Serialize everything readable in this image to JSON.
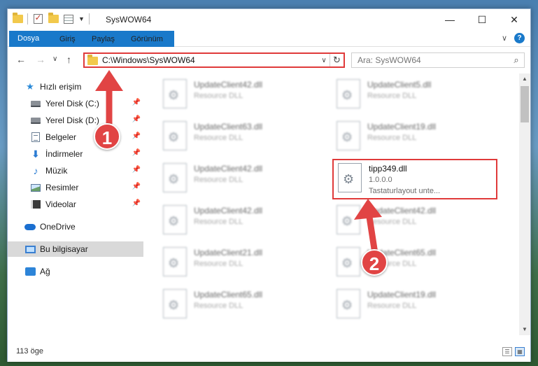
{
  "window": {
    "title": "SysWOW64",
    "controls": {
      "minimize": "—",
      "maximize": "☐",
      "close": "✕"
    }
  },
  "ribbon": {
    "tabs": [
      "Dosya",
      "Giriş",
      "Paylaş",
      "Görünüm"
    ],
    "expand": "∨",
    "help": "?"
  },
  "nav": {
    "back": "←",
    "forward": "→",
    "recent": "∨",
    "up": "↑",
    "address": "C:\\Windows\\SysWOW64",
    "address_dropdown": "∨",
    "refresh": "↻",
    "search_placeholder": "Ara: SysWOW64",
    "search_icon": "⌕"
  },
  "sidebar": {
    "items": [
      {
        "label": "Hızlı erişim",
        "icon": "star-icon",
        "pinned": false
      },
      {
        "label": "Yerel Disk (C:)",
        "icon": "drive-icon",
        "pinned": true
      },
      {
        "label": "Yerel Disk (D:)",
        "icon": "drive-icon",
        "pinned": true
      },
      {
        "label": "Belgeler",
        "icon": "documents-icon",
        "pinned": true
      },
      {
        "label": "İndirmeler",
        "icon": "download-icon",
        "pinned": true
      },
      {
        "label": "Müzik",
        "icon": "music-icon",
        "pinned": true
      },
      {
        "label": "Resimler",
        "icon": "pictures-icon",
        "pinned": true
      },
      {
        "label": "Videolar",
        "icon": "videos-icon",
        "pinned": true
      },
      {
        "label": "OneDrive",
        "icon": "onedrive-icon",
        "pinned": false
      },
      {
        "label": "Bu bilgisayar",
        "icon": "computer-icon",
        "pinned": false,
        "selected": true
      },
      {
        "label": "Ağ",
        "icon": "network-icon",
        "pinned": false
      }
    ],
    "pin_glyph": "📌"
  },
  "files": {
    "left": [
      {
        "name": "UpdateClient42.dll",
        "desc": "Resource DLL"
      },
      {
        "name": "UpdateClient63.dll",
        "desc": "Resource DLL"
      },
      {
        "name": "UpdateClient42.dll",
        "desc": "Resource DLL"
      },
      {
        "name": "UpdateClient42.dll",
        "desc": "Resource DLL"
      },
      {
        "name": "UpdateClient21.dll",
        "desc": "Resource DLL"
      },
      {
        "name": "UpdateClient65.dll",
        "desc": "Resource DLL"
      }
    ],
    "right": [
      {
        "name": "UpdateClient5.dll",
        "desc": "Resource DLL"
      },
      {
        "name": "UpdateClient19.dll",
        "desc": "Resource DLL"
      },
      {
        "name": "tipp349.dll",
        "desc": "1.0.0.0",
        "desc2": "Tastaturlayout unte...",
        "highlight": true
      },
      {
        "name": "UpdateClient42.dll",
        "desc": "Resource DLL"
      },
      {
        "name": "UpdateClient65.dll",
        "desc": "Resource DLL"
      },
      {
        "name": "UpdateClient19.dll",
        "desc": "Resource DLL"
      }
    ]
  },
  "statusbar": {
    "count": "113 öge"
  },
  "annotations": {
    "step1": "1",
    "step2": "2",
    "color": "#e14444"
  }
}
